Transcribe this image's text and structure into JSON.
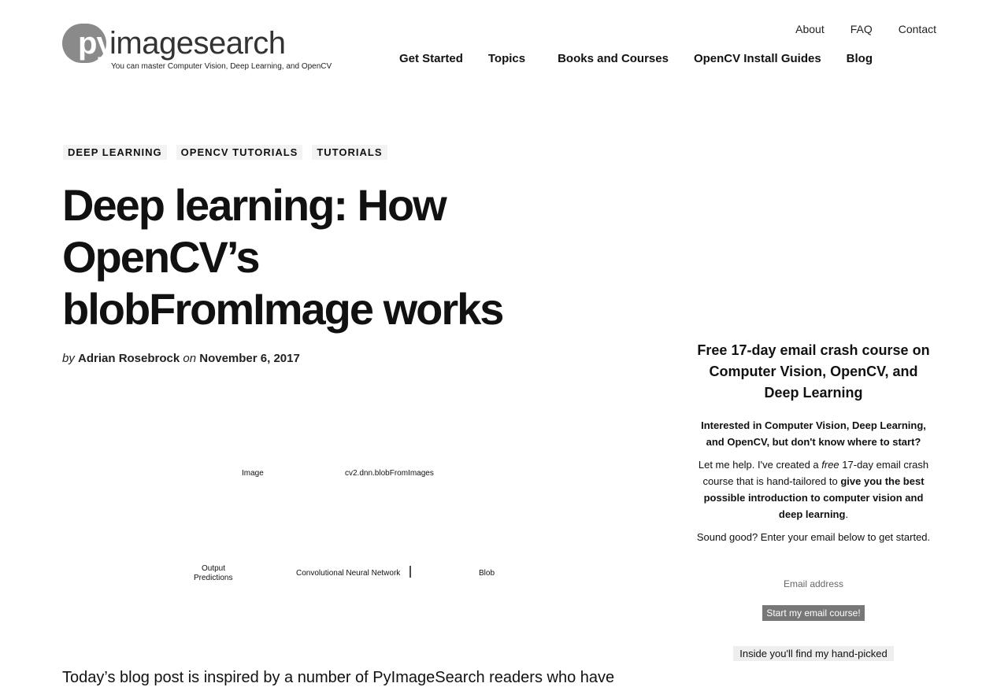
{
  "header": {
    "logo": {
      "py": "py",
      "name": "imagesearch",
      "tagline": "You can master Computer Vision, Deep Learning, and OpenCV"
    },
    "top_links": [
      "About",
      "FAQ",
      "Contact"
    ],
    "main_nav": [
      "Get Started",
      "Topics",
      "Books and Courses",
      "OpenCV Install Guides",
      "Blog"
    ]
  },
  "post": {
    "categories": [
      "DEEP LEARNING",
      "OPENCV TUTORIALS",
      "TUTORIALS"
    ],
    "title": "Deep learning: How OpenCV’s blobFromImage works",
    "byline": {
      "by": "by",
      "author": "Adrian Rosebrock",
      "on": "on",
      "date": "November 6, 2017"
    },
    "figure": {
      "labels": {
        "image": "Image",
        "blob_fn": "cv2.dnn.blobFromImages",
        "output_l1": "Output",
        "output_l2": "Predictions",
        "cnn": "Convolutional Neural Network",
        "blob": "Blob"
      }
    },
    "intro": "Today’s blog post is inspired by a number of PyImageSearch readers who have"
  },
  "sidebar": {
    "heading": "Free 17-day email crash course on Computer Vision, OpenCV, and Deep Learning",
    "p1": "Interested in Computer Vision, Deep Learning, and OpenCV, but don't know where to start?",
    "p2_a": "Let me help. I've created a ",
    "p2_free": "free",
    "p2_b": " 17-day email crash course that is hand-tailored to ",
    "p2_bold": "give you the best possible introduction to computer vision and deep learning",
    "p2_c": ".",
    "p3": "Sound good? Enter your email below to get started.",
    "email_placeholder": "Email address",
    "submit_label": "Start my email course!",
    "inside_label": "Inside you'll find my hand-picked"
  }
}
